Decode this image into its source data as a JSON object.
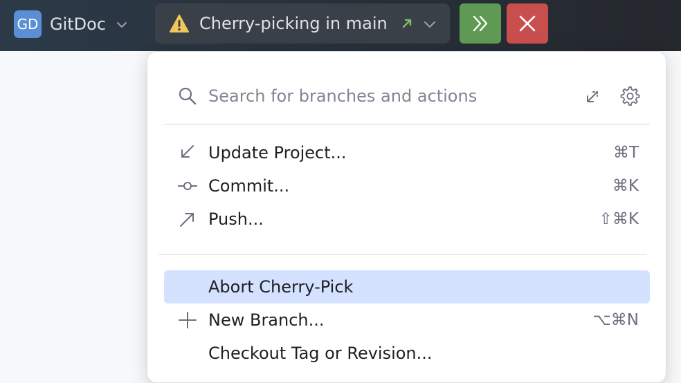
{
  "toolbar": {
    "project_badge": "GD",
    "project_name": "GitDoc",
    "branch_widget_label": "Cherry-picking in main",
    "icons": {
      "project_dropdown": "chevron-down-icon",
      "warning": "warning-icon",
      "push_status": "outgoing-arrow-icon",
      "branch_dropdown": "chevron-down-icon",
      "continue": "double-chevron-right-icon",
      "abort": "close-icon"
    },
    "colors": {
      "continue_button": "#5f9a55",
      "abort_button": "#c94f4f",
      "warning": "#f2c55c",
      "push_arrow": "#7fbf5f"
    }
  },
  "popup": {
    "search": {
      "placeholder": "Search for branches and actions",
      "value": ""
    },
    "icons": {
      "search": "search-icon",
      "collapse": "collapse-arrow-icon",
      "settings": "gear-icon"
    },
    "items": [
      {
        "label": "Update Project...",
        "shortcut": "⌘T",
        "icon": "update-arrow-icon",
        "selected": false
      },
      {
        "label": "Commit...",
        "shortcut": "⌘K",
        "icon": "commit-icon",
        "selected": false
      },
      {
        "label": "Push...",
        "shortcut": "⇧⌘K",
        "icon": "push-arrow-icon",
        "selected": false
      },
      {
        "label": "Abort Cherry-Pick",
        "shortcut": "",
        "icon": "",
        "selected": true
      },
      {
        "label": "New Branch...",
        "shortcut": "⌥⌘N",
        "icon": "plus-icon",
        "selected": false
      },
      {
        "label": "Checkout Tag or Revision...",
        "shortcut": "",
        "icon": "",
        "selected": false
      }
    ],
    "colors": {
      "selection": "#d4e2ff"
    }
  }
}
